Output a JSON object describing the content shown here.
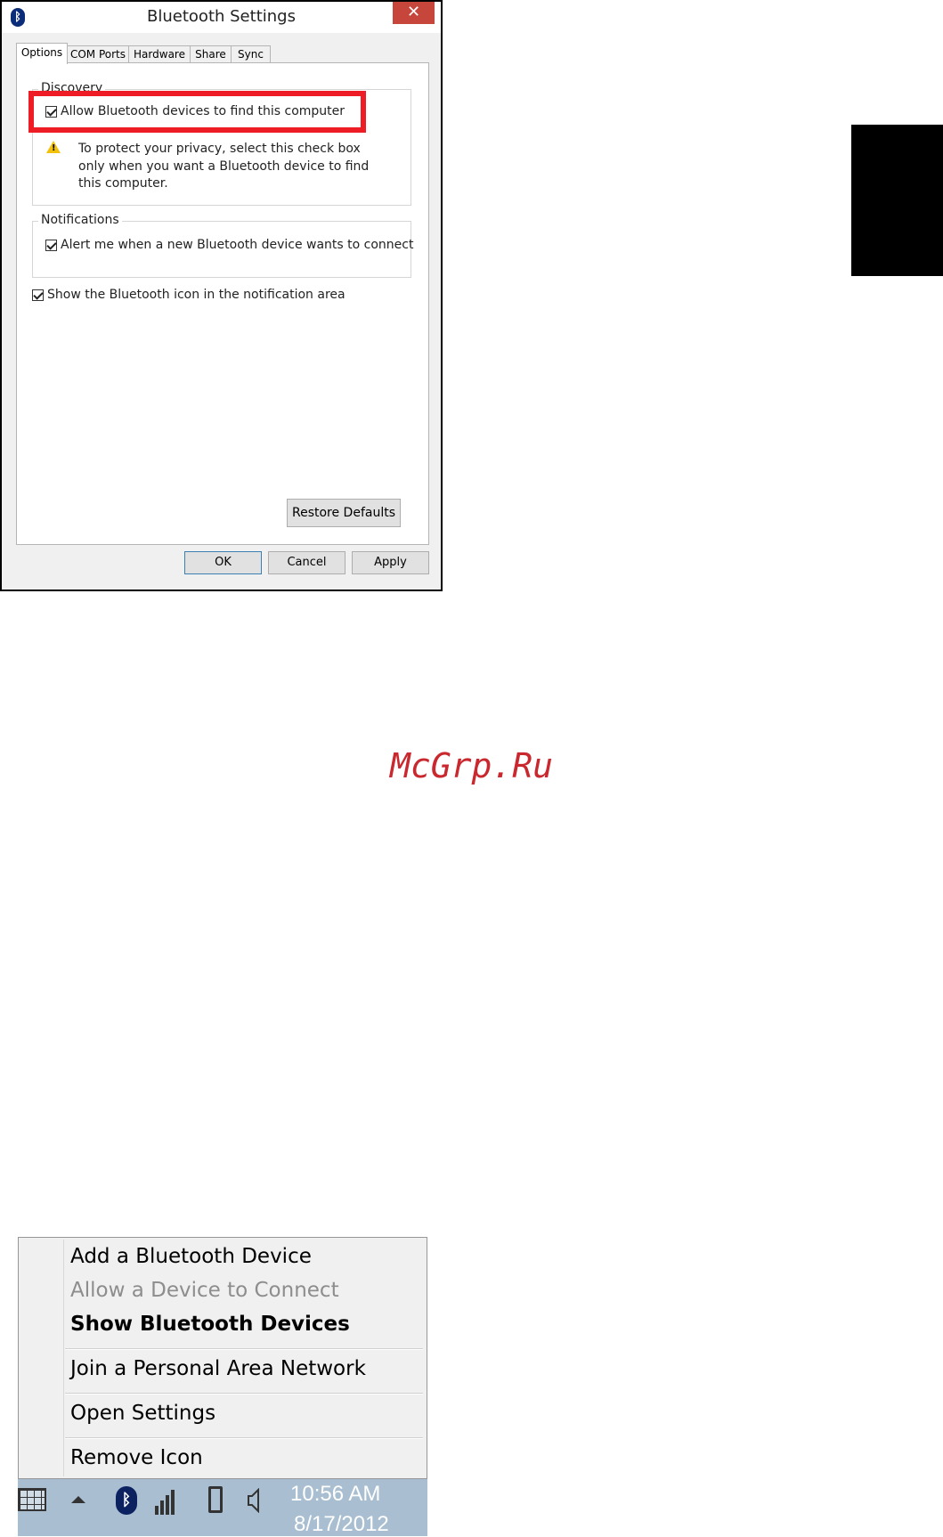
{
  "dialog": {
    "title": "Bluetooth Settings",
    "close_glyph": "✕",
    "bluetooth_glyph": "ᛒ",
    "tabs": [
      "Options",
      "COM Ports",
      "Hardware",
      "Share",
      "Sync"
    ],
    "active_tab": "Options",
    "discovery": {
      "label": "Discovery",
      "allow_label": "Allow Bluetooth devices to find this computer",
      "allow_checked": true,
      "warning": "To protect your privacy, select this check box only when you want a Bluetooth device to find this computer."
    },
    "notifications": {
      "label": "Notifications",
      "alert_label": "Alert me when a new Bluetooth device wants to connect",
      "alert_checked": true
    },
    "show_icon_label": "Show the Bluetooth icon in the notification area",
    "show_icon_checked": true,
    "restore_defaults": "Restore Defaults",
    "ok": "OK",
    "cancel": "Cancel",
    "apply": "Apply"
  },
  "watermark": "McGrp.Ru",
  "context_menu": {
    "items": [
      {
        "label": "Add a Bluetooth Device",
        "state": "normal"
      },
      {
        "label": "Allow a Device to Connect",
        "state": "disabled"
      },
      {
        "label": "Show Bluetooth Devices",
        "state": "default"
      },
      {
        "label": "Join a Personal Area Network",
        "state": "normal"
      },
      {
        "label": "Open Settings",
        "state": "normal"
      },
      {
        "label": "Remove Icon",
        "state": "normal"
      }
    ]
  },
  "taskbar": {
    "time": "10:56 AM",
    "date": "8/17/2012",
    "bluetooth_glyph": "ᛒ",
    "icons": [
      "touch-keyboard-icon",
      "show-hidden-icons-icon",
      "bluetooth-icon",
      "network-signal-icon",
      "battery-icon",
      "speaker-icon"
    ]
  },
  "colors": {
    "highlight_box": "#ee1c25",
    "close_button": "#c7463b",
    "taskbar": "#a9bfd1",
    "watermark": "#c8282e"
  }
}
